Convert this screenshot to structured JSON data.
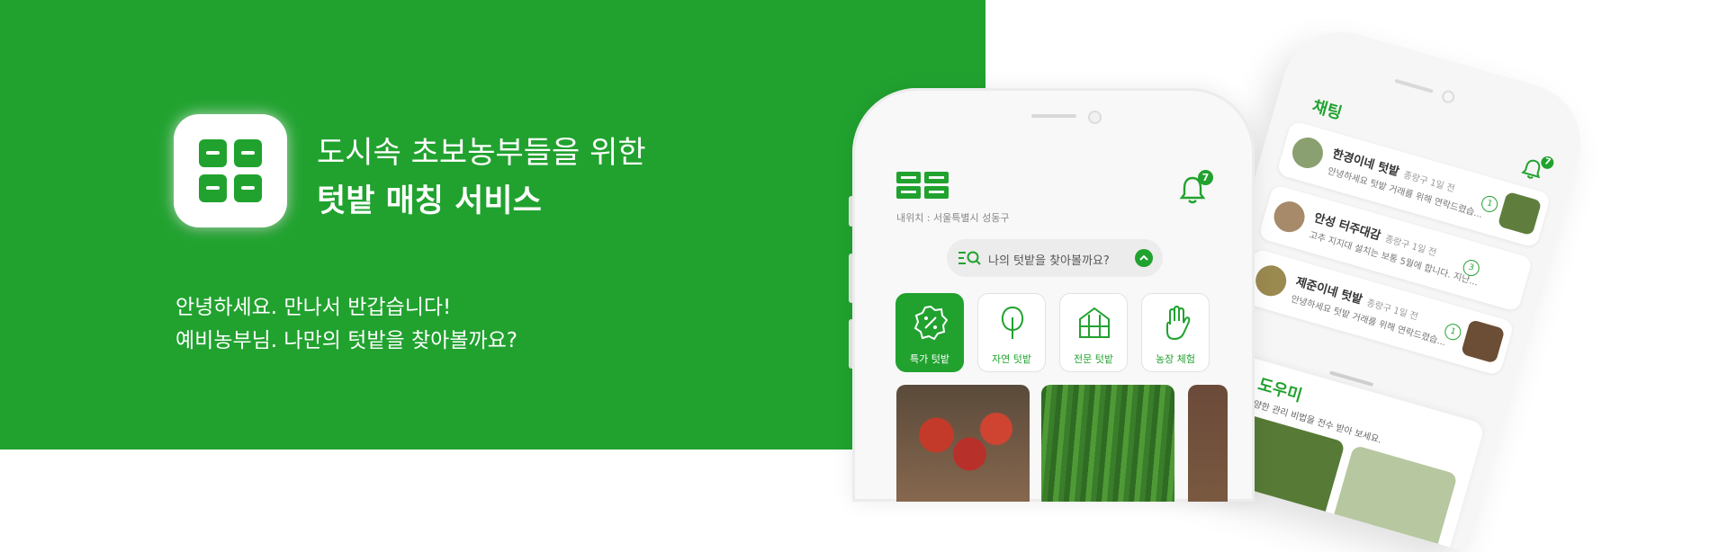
{
  "hero": {
    "headline_line1": "도시속 초보농부들을 위한",
    "headline_line2": "텃밭 매칭 서비스",
    "greeting_line1": "안녕하세요. 만나서 반갑습니다!",
    "greeting_line2": "예비농부님. 나만의 텃밭을 찾아볼까요?"
  },
  "colors": {
    "brand_green": "#21a22f",
    "background": "#ffffff"
  },
  "home_screen": {
    "logo_icon": "app-logo-icon",
    "location": "내위치 : 서울특별시 성동구",
    "notification_count": "7",
    "search_placeholder": "나의 텃밭을 찾아볼까요?",
    "categories": [
      {
        "label": "특가 텃밭",
        "icon": "discount-badge-icon",
        "active": true
      },
      {
        "label": "자연 텃밭",
        "icon": "tree-icon",
        "active": false
      },
      {
        "label": "전문 텃밭",
        "icon": "greenhouse-icon",
        "active": false
      },
      {
        "label": "농장 체험",
        "icon": "hand-icon",
        "active": false
      }
    ]
  },
  "chat_screen": {
    "title": "채팅",
    "notification_count": "7",
    "chats": [
      {
        "name": "한경이네 텃밭",
        "meta": "종랑구 1일 전",
        "message": "안녕하세요 텃밭 거래를 위해 연락드렸습...",
        "count": "1"
      },
      {
        "name": "안성 터주대감",
        "meta": "종랑구 1일 전",
        "message": "고추 지지대 설치는 보통 5월에 합니다. 지난...",
        "count": "3"
      },
      {
        "name": "제준이네 텃밭",
        "meta": "종랑구 1일 전",
        "message": "안녕하세요 텃밭 거래를 위해 연락드렸습...",
        "count": "1"
      }
    ],
    "helper_title": "텃밭 도우미",
    "helper_desc": "들에게 다양한 관리 비법을 전수 받아 보세요."
  }
}
